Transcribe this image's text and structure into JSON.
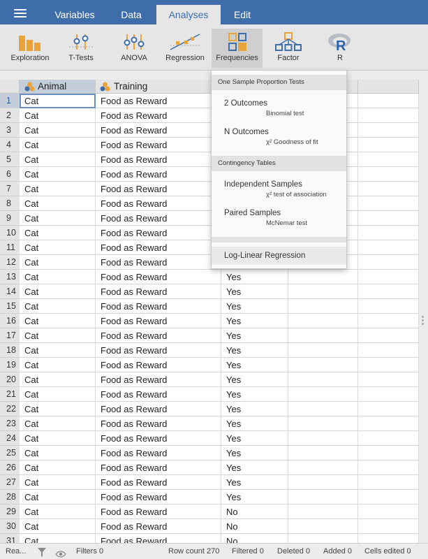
{
  "topbar": {
    "tabs": [
      {
        "label": "Variables"
      },
      {
        "label": "Data"
      },
      {
        "label": "Analyses"
      },
      {
        "label": "Edit"
      }
    ],
    "active_tab": "Analyses",
    "bg_color": "#3e6da9"
  },
  "ribbon": {
    "buttons": [
      {
        "label": "Exploration",
        "icon": "exploration-bars-icon"
      },
      {
        "label": "T-Tests",
        "icon": "ttests-icon"
      },
      {
        "label": "ANOVA",
        "icon": "anova-icon"
      },
      {
        "label": "Regression",
        "icon": "regression-icon"
      },
      {
        "label": "Frequencies",
        "icon": "frequencies-icon"
      },
      {
        "label": "Factor",
        "icon": "factor-icon"
      },
      {
        "label": "R",
        "icon": "r-icon"
      }
    ],
    "active_button": "Frequencies"
  },
  "sheet": {
    "columns": [
      {
        "name": "Animal",
        "icon": "nominal-variable-icon"
      },
      {
        "name": "Training",
        "icon": "nominal-variable-icon"
      }
    ],
    "rows": [
      {
        "n": "1",
        "animal": "Cat",
        "training": "Food as Reward",
        "dance": ""
      },
      {
        "n": "2",
        "animal": "Cat",
        "training": "Food as Reward",
        "dance": ""
      },
      {
        "n": "3",
        "animal": "Cat",
        "training": "Food as Reward",
        "dance": ""
      },
      {
        "n": "4",
        "animal": "Cat",
        "training": "Food as Reward",
        "dance": ""
      },
      {
        "n": "5",
        "animal": "Cat",
        "training": "Food as Reward",
        "dance": ""
      },
      {
        "n": "6",
        "animal": "Cat",
        "training": "Food as Reward",
        "dance": ""
      },
      {
        "n": "7",
        "animal": "Cat",
        "training": "Food as Reward",
        "dance": ""
      },
      {
        "n": "8",
        "animal": "Cat",
        "training": "Food as Reward",
        "dance": ""
      },
      {
        "n": "9",
        "animal": "Cat",
        "training": "Food as Reward",
        "dance": ""
      },
      {
        "n": "10",
        "animal": "Cat",
        "training": "Food as Reward",
        "dance": ""
      },
      {
        "n": "11",
        "animal": "Cat",
        "training": "Food as Reward",
        "dance": ""
      },
      {
        "n": "12",
        "animal": "Cat",
        "training": "Food as Reward",
        "dance": ""
      },
      {
        "n": "13",
        "animal": "Cat",
        "training": "Food as Reward",
        "dance": "Yes"
      },
      {
        "n": "14",
        "animal": "Cat",
        "training": "Food as Reward",
        "dance": "Yes"
      },
      {
        "n": "15",
        "animal": "Cat",
        "training": "Food as Reward",
        "dance": "Yes"
      },
      {
        "n": "16",
        "animal": "Cat",
        "training": "Food as Reward",
        "dance": "Yes"
      },
      {
        "n": "17",
        "animal": "Cat",
        "training": "Food as Reward",
        "dance": "Yes"
      },
      {
        "n": "18",
        "animal": "Cat",
        "training": "Food as Reward",
        "dance": "Yes"
      },
      {
        "n": "19",
        "animal": "Cat",
        "training": "Food as Reward",
        "dance": "Yes"
      },
      {
        "n": "20",
        "animal": "Cat",
        "training": "Food as Reward",
        "dance": "Yes"
      },
      {
        "n": "21",
        "animal": "Cat",
        "training": "Food as Reward",
        "dance": "Yes"
      },
      {
        "n": "22",
        "animal": "Cat",
        "training": "Food as Reward",
        "dance": "Yes"
      },
      {
        "n": "23",
        "animal": "Cat",
        "training": "Food as Reward",
        "dance": "Yes"
      },
      {
        "n": "24",
        "animal": "Cat",
        "training": "Food as Reward",
        "dance": "Yes"
      },
      {
        "n": "25",
        "animal": "Cat",
        "training": "Food as Reward",
        "dance": "Yes"
      },
      {
        "n": "26",
        "animal": "Cat",
        "training": "Food as Reward",
        "dance": "Yes"
      },
      {
        "n": "27",
        "animal": "Cat",
        "training": "Food as Reward",
        "dance": "Yes"
      },
      {
        "n": "28",
        "animal": "Cat",
        "training": "Food as Reward",
        "dance": "Yes"
      },
      {
        "n": "29",
        "animal": "Cat",
        "training": "Food as Reward",
        "dance": "No"
      },
      {
        "n": "30",
        "animal": "Cat",
        "training": "Food as Reward",
        "dance": "No"
      },
      {
        "n": "31",
        "animal": "Cat",
        "training": "Food as Reward",
        "dance": "No"
      }
    ],
    "selected_row": "1"
  },
  "menu": {
    "sections": [
      {
        "title": "One Sample Proportion Tests",
        "items": [
          {
            "label": "2 Outcomes",
            "sub": "Binomial test"
          },
          {
            "label": "N Outcomes",
            "sub": "χ² Goodness of fit"
          }
        ]
      },
      {
        "title": "Contingency Tables",
        "items": [
          {
            "label": "Independent Samples",
            "sub": "χ² test of association"
          },
          {
            "label": "Paired Samples",
            "sub": "McNemar test"
          }
        ]
      }
    ],
    "loglinear": "Log-Linear Regression"
  },
  "status": {
    "ready": "Rea...",
    "filters": "Filters 0",
    "row_count": "Row count 270",
    "filtered": "Filtered 0",
    "deleted": "Deleted 0",
    "added": "Added 0",
    "cells_edited": "Cells edited 0"
  }
}
